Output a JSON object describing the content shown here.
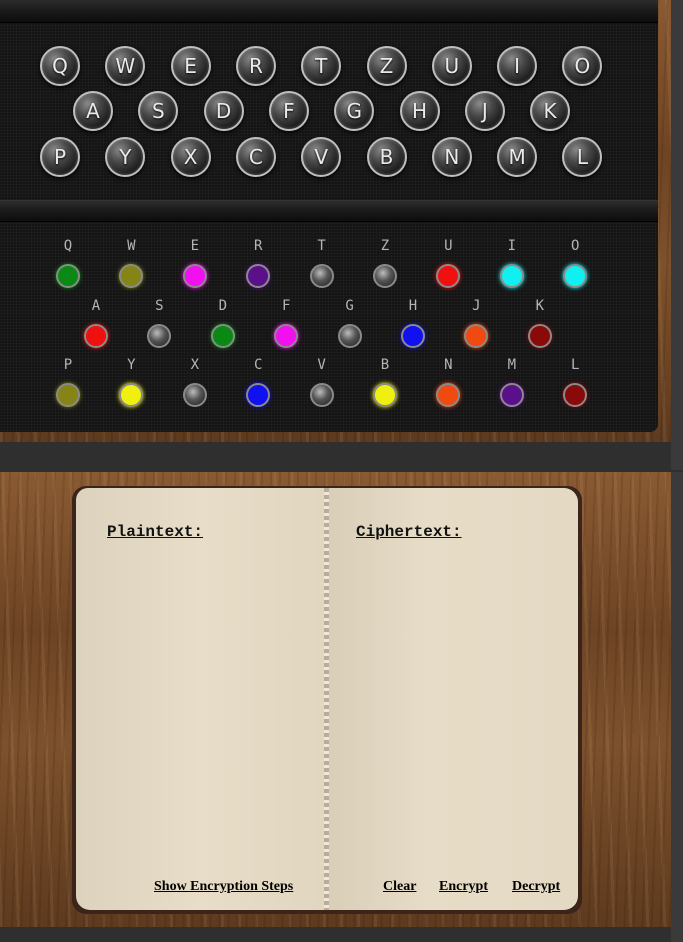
{
  "keyboard": {
    "row1": [
      "Q",
      "W",
      "E",
      "R",
      "T",
      "Z",
      "U",
      "I",
      "O"
    ],
    "row2": [
      "A",
      "S",
      "D",
      "F",
      "G",
      "H",
      "J",
      "K"
    ],
    "row3": [
      "P",
      "Y",
      "X",
      "C",
      "V",
      "B",
      "N",
      "M",
      "L"
    ]
  },
  "lampboard": {
    "row1": [
      {
        "label": "Q",
        "color": "#0a8a14"
      },
      {
        "label": "W",
        "color": "#858516"
      },
      {
        "label": "E",
        "color": "#f010f0"
      },
      {
        "label": "R",
        "color": "#5a108a"
      },
      {
        "label": "T",
        "color": "off"
      },
      {
        "label": "Z",
        "color": "off"
      },
      {
        "label": "U",
        "color": "#f01010"
      },
      {
        "label": "I",
        "color": "#10f0f0"
      },
      {
        "label": "O",
        "color": "#10f0f0"
      }
    ],
    "row2": [
      {
        "label": "A",
        "color": "#f01010"
      },
      {
        "label": "S",
        "color": "off"
      },
      {
        "label": "D",
        "color": "#0a8a14"
      },
      {
        "label": "F",
        "color": "#f010f0"
      },
      {
        "label": "G",
        "color": "off"
      },
      {
        "label": "H",
        "color": "#1010f0"
      },
      {
        "label": "J",
        "color": "#f04a10"
      },
      {
        "label": "K",
        "color": "#8a0a0a"
      }
    ],
    "row3": [
      {
        "label": "P",
        "color": "#858516"
      },
      {
        "label": "Y",
        "color": "#f0f010"
      },
      {
        "label": "X",
        "color": "off"
      },
      {
        "label": "C",
        "color": "#1010f0"
      },
      {
        "label": "V",
        "color": "off"
      },
      {
        "label": "B",
        "color": "#f0f010"
      },
      {
        "label": "N",
        "color": "#f04a10"
      },
      {
        "label": "M",
        "color": "#5a108a"
      },
      {
        "label": "L",
        "color": "#8a0a0a"
      }
    ]
  },
  "notebook": {
    "plaintext_heading": "Plaintext:",
    "ciphertext_heading": "Ciphertext:",
    "show_steps_label": "Show Encryption Steps",
    "clear_label": "Clear",
    "encrypt_label": "Encrypt",
    "decrypt_label": "Decrypt"
  }
}
